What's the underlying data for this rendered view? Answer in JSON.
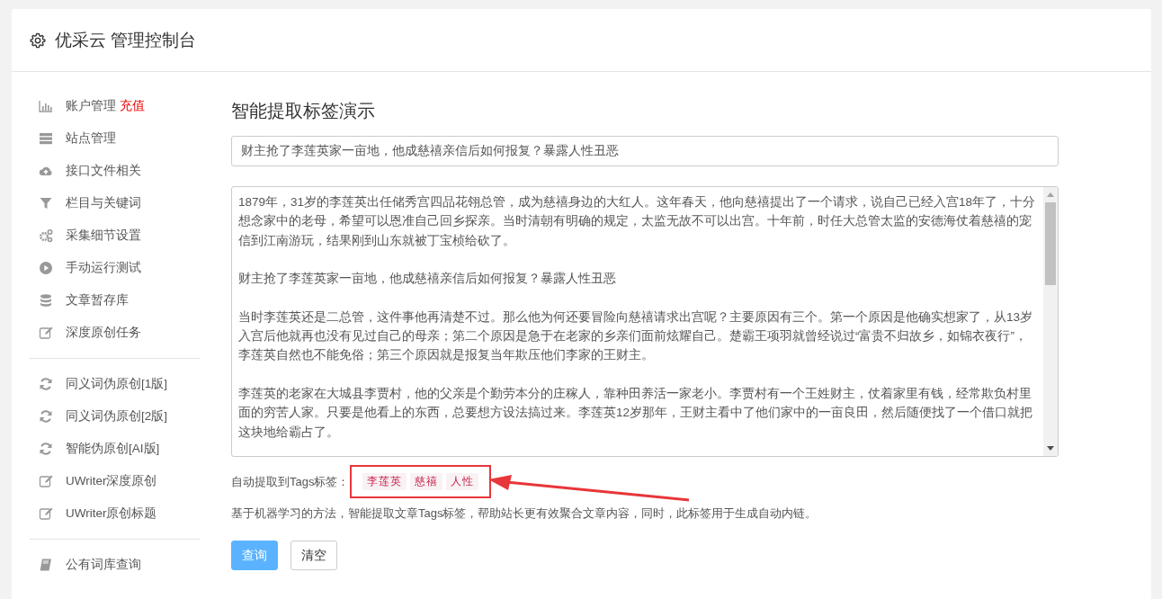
{
  "header": {
    "title": "优采云 管理控制台"
  },
  "sidebar": {
    "groups": [
      [
        {
          "label": "账户管理",
          "badge": "充值"
        },
        {
          "label": "站点管理"
        },
        {
          "label": "接口文件相关"
        },
        {
          "label": "栏目与关键词"
        },
        {
          "label": "采集细节设置"
        },
        {
          "label": "手动运行测试"
        },
        {
          "label": "文章暂存库"
        },
        {
          "label": "深度原创任务"
        }
      ],
      [
        {
          "label": "同义词伪原创[1版]"
        },
        {
          "label": "同义词伪原创[2版]"
        },
        {
          "label": "智能伪原创[AI版]"
        },
        {
          "label": "UWriter深度原创"
        },
        {
          "label": "UWriter原创标题"
        }
      ],
      [
        {
          "label": "公有词库查询"
        }
      ]
    ]
  },
  "main": {
    "heading": "智能提取标签演示",
    "title_field": {
      "value": "财主抢了李莲英家一亩地，他成慈禧亲信后如何报复？暴露人性丑恶"
    },
    "article": {
      "paragraphs": [
        "1879年，31岁的李莲英出任储秀宫四品花翎总管，成为慈禧身边的大红人。这年春天，他向慈禧提出了一个请求，说自己已经入宫18年了，十分想念家中的老母，希望可以恩准自己回乡探亲。当时清朝有明确的规定，太监无故不可以出宫。十年前，时任大总管太监的安德海仗着慈禧的宠信到江南游玩，结果刚到山东就被丁宝桢给砍了。",
        "财主抢了李莲英家一亩地，他成慈禧亲信后如何报复？暴露人性丑恶",
        "当时李莲英还是二总管，这件事他再清楚不过。那么他为何还要冒险向慈禧请求出宫呢？主要原因有三个。第一个原因是他确实想家了，从13岁入宫后他就再也没有见过自己的母亲；第二个原因是急于在老家的乡亲们面前炫耀自己。楚霸王项羽就曾经说过“富贵不归故乡，如锦衣夜行”，李莲英自然也不能免俗；第三个原因就是报复当年欺压他们李家的王财主。",
        "李莲英的老家在大城县李贾村，他的父亲是个勤劳本分的庄稼人，靠种田养活一家老小。李贾村有一个王姓财主，仗着家里有钱，经常欺负村里面的穷苦人家。只要是他看上的东西，总要想方设法搞过来。李莲英12岁那年，王财主看中了他们家中的一亩良田，然后随便找了一个借口就把这块地给霸占了。"
      ]
    },
    "tags": {
      "label": "自动提取到Tags标签：",
      "items": [
        "李莲英",
        "慈禧",
        "人性"
      ]
    },
    "description": "基于机器学习的方法，智能提取文章Tags标签，帮助站长更有效聚合文章内容，同时，此标签用于生成自动内链。",
    "buttons": [
      {
        "label": "查询",
        "kind": "primary"
      },
      {
        "label": "清空",
        "kind": "default"
      }
    ]
  }
}
